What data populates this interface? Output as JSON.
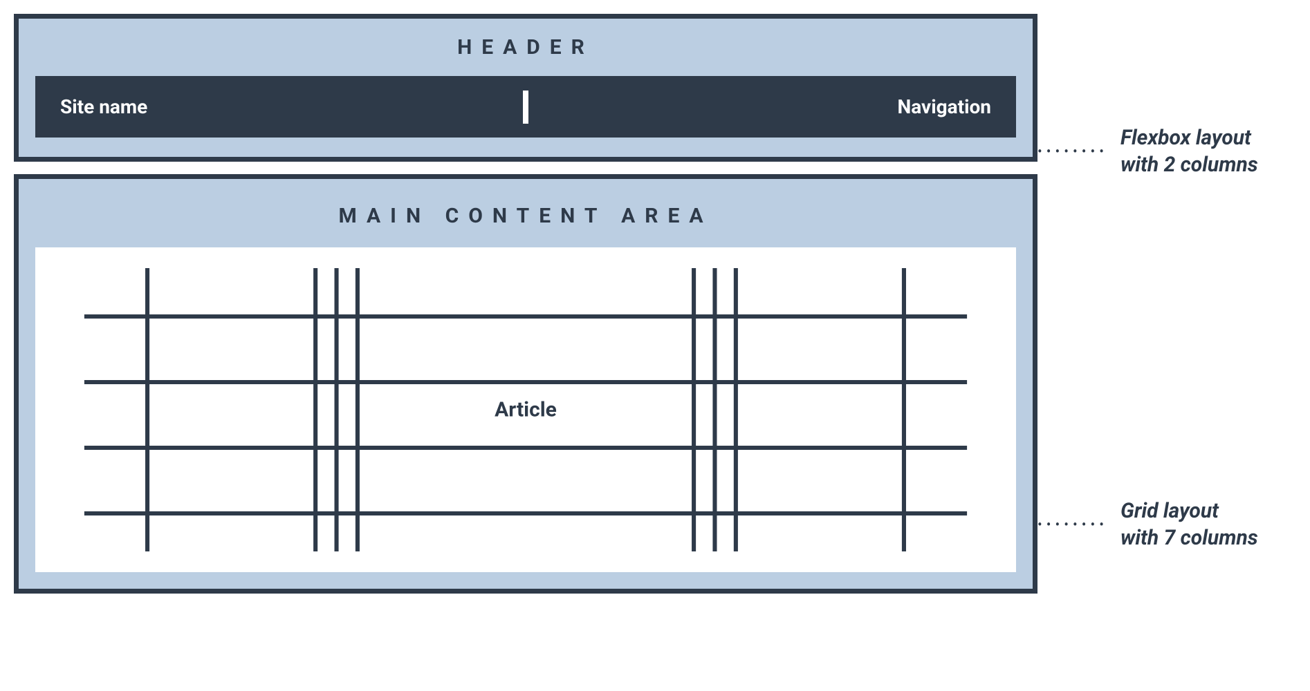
{
  "header": {
    "title": "HEADER",
    "site_name": "Site name",
    "navigation": "Navigation"
  },
  "main": {
    "title": "MAIN CONTENT AREA",
    "article_label": "Article",
    "grid_columns": 7,
    "grid_rows_visible": 4
  },
  "annotations": {
    "flexbox": "Flexbox layout\nwith 2 columns",
    "grid": "Grid layout\nwith 7 columns"
  },
  "colors": {
    "panel_bg": "#BBCEE2",
    "border_dark": "#2E3A49",
    "navbar_bg": "#2E3A49",
    "navbar_text": "#FFFFFF",
    "article_bg": "#FFFFFF"
  }
}
